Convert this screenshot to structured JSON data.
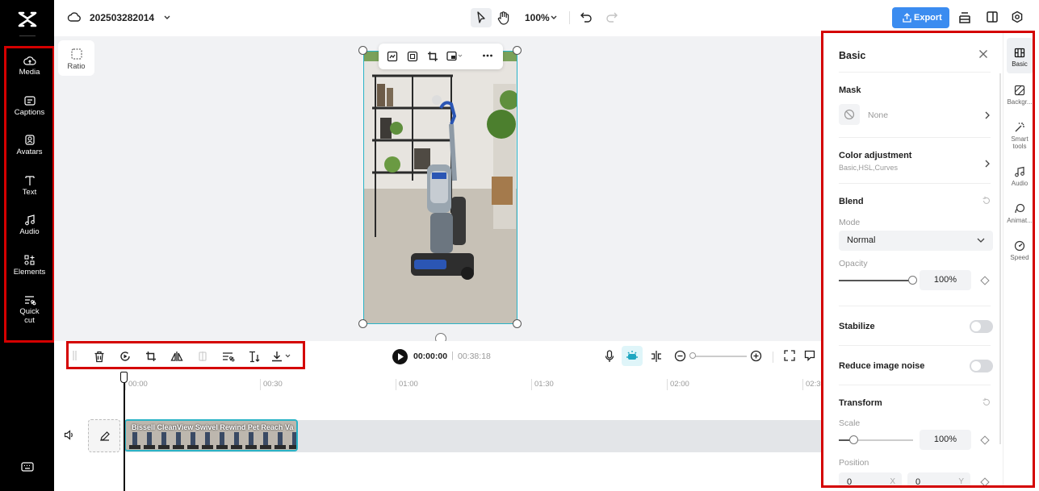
{
  "app": {
    "name": "CapCut"
  },
  "sidebar": {
    "items": [
      {
        "label": "Media",
        "icon": "cloud-upload-icon"
      },
      {
        "label": "Captions",
        "icon": "captions-icon"
      },
      {
        "label": "Avatars",
        "icon": "avatar-icon"
      },
      {
        "label": "Text",
        "icon": "text-icon"
      },
      {
        "label": "Audio",
        "icon": "music-note-icon"
      },
      {
        "label": "Elements",
        "icon": "elements-icon"
      },
      {
        "label": "Quick cut",
        "label_line2": "cut",
        "label_line1": "Quick",
        "icon": "quick-cut-icon"
      }
    ]
  },
  "topbar": {
    "project_name": "202503282014",
    "zoom": "100%",
    "export_label": "Export"
  },
  "canvas": {
    "ratio_label": "Ratio"
  },
  "playback": {
    "current_time": "00:00:00",
    "separator": "|",
    "total_time": "00:38:18"
  },
  "timeline": {
    "ticks": [
      "00:00",
      "00:30",
      "01:00",
      "01:30",
      "02:00",
      "02:30"
    ],
    "clip_title": "Bissell CleanView Swivel Rewind Pet Reach Va"
  },
  "panel": {
    "title": "Basic",
    "mask": {
      "title": "Mask",
      "value": "None"
    },
    "color_adjustment": {
      "title": "Color adjustment",
      "subtitle": "Basic,HSL,Curves"
    },
    "blend": {
      "title": "Blend",
      "mode_label": "Mode",
      "mode_value": "Normal",
      "opacity_label": "Opacity",
      "opacity_value": "100%",
      "opacity_fraction": 1.0
    },
    "stabilize": {
      "title": "Stabilize",
      "on": false
    },
    "reduce_noise": {
      "title": "Reduce image noise",
      "on": false
    },
    "transform": {
      "title": "Transform",
      "scale_label": "Scale",
      "scale_value": "100%",
      "position_label": "Position",
      "pos_x": "0",
      "pos_y": "0",
      "axis_x": "X",
      "axis_y": "Y"
    },
    "tabs": [
      {
        "label": "Basic",
        "icon": "basic-icon"
      },
      {
        "label": "Backgr...",
        "icon": "background-icon"
      },
      {
        "label": "Smart tools",
        "line1": "Smart",
        "line2": "tools",
        "icon": "magic-wand-icon"
      },
      {
        "label": "Audio",
        "icon": "music-note-icon"
      },
      {
        "label": "Animat...",
        "icon": "animation-icon"
      },
      {
        "label": "Speed",
        "icon": "speed-icon"
      }
    ]
  },
  "colors": {
    "accent": "#3b8cf0",
    "highlight": "#d40000",
    "selection": "#2ab3c6"
  }
}
